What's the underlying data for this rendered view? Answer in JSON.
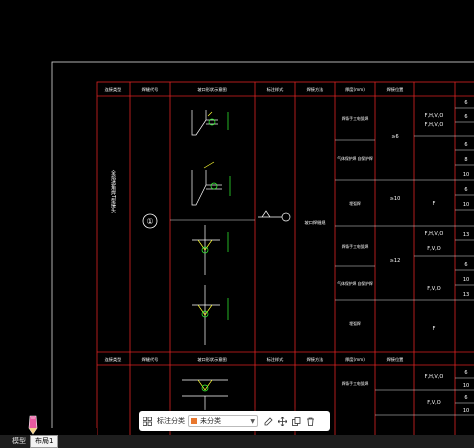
{
  "table": {
    "headers": [
      "连接类型",
      "焊缝代号",
      "坡口形状示意图",
      "标注样式",
      "焊接方法",
      "厚度(mm)",
      "焊接位置"
    ],
    "section_title": "全熔透角焊T型接头",
    "weld_no": "①",
    "weld_method_col": "坡口焊缝规",
    "methods": [
      "焊条手工电弧焊",
      "气体保护焊\n自保护焊",
      "埋弧焊",
      "焊条手工电弧焊",
      "气体保护焊\n自保护焊",
      "埋弧焊"
    ],
    "thickness": [
      "≥6",
      "≥10",
      "≥12"
    ],
    "positions": [
      "F,H,V,O",
      "F,H,V,O",
      "F",
      "F,H,V,O",
      "F,V,O",
      "F,V,O",
      "F"
    ],
    "right_vals": [
      "6",
      "6",
      "6",
      "8",
      "10",
      "6",
      "10",
      "13",
      "6",
      "10",
      "13"
    ],
    "second_headers": [
      "连接类型",
      "焊缝代号",
      "坡口形状示意图",
      "标注样式",
      "焊接方法",
      "厚度(mm)",
      "焊接位置"
    ],
    "second_positions": [
      "F,H,V,O",
      "F,V,O"
    ],
    "second_vals": [
      "6",
      "10",
      "6",
      "10"
    ],
    "second_method": "焊条手工电弧焊"
  },
  "toolbar": {
    "label": "标注分类",
    "category": "未分类",
    "category_color": "#e8772e"
  },
  "tabs": [
    "模型",
    "布局1"
  ]
}
